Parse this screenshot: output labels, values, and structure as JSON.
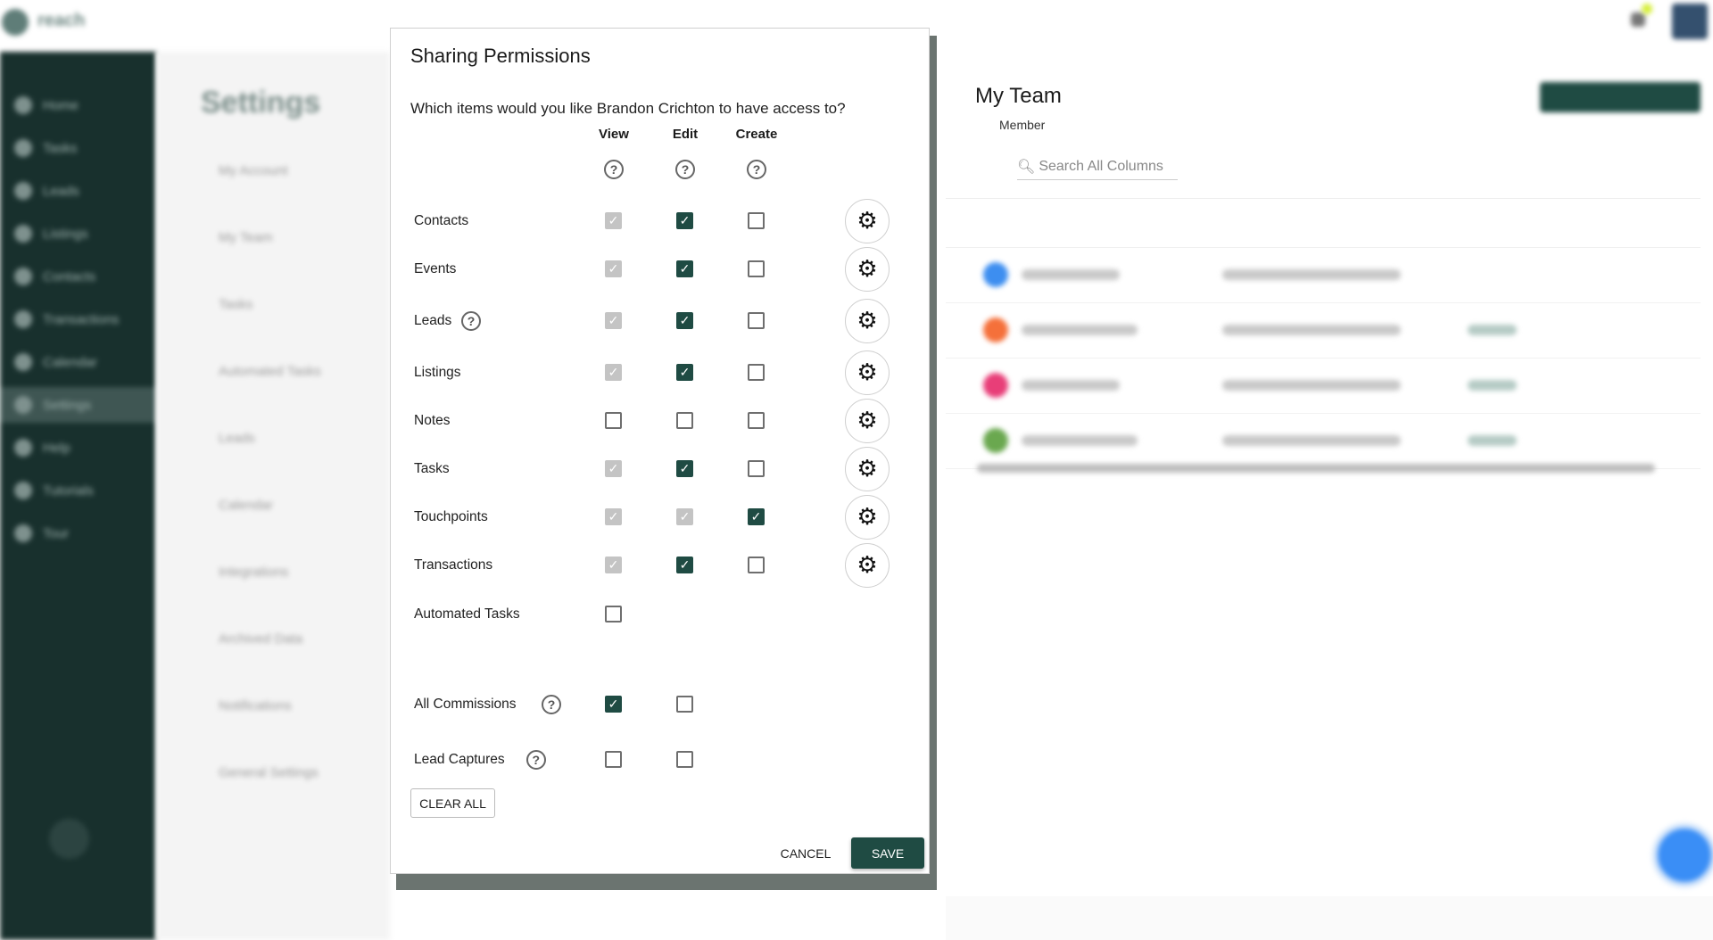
{
  "app": {
    "logo_text": "reach"
  },
  "sidebar": {
    "items": [
      {
        "label": "Home"
      },
      {
        "label": "Tasks"
      },
      {
        "label": "Leads"
      },
      {
        "label": "Listings"
      },
      {
        "label": "Contacts"
      },
      {
        "label": "Transactions"
      },
      {
        "label": "Calendar"
      },
      {
        "label": "Settings",
        "active": true
      },
      {
        "label": "Help"
      },
      {
        "label": "Tutorials"
      },
      {
        "label": "Tour"
      }
    ]
  },
  "settings": {
    "title": "Settings",
    "items": [
      "My Account",
      "My Team",
      "Tasks",
      "Automated Tasks",
      "Leads",
      "Calendar",
      "Integrations",
      "Archived Data",
      "Notifications",
      "General Settings"
    ]
  },
  "team": {
    "title": "My Team",
    "search_placeholder": "Search All Columns",
    "columns": {
      "member": "Member"
    },
    "avatar_colors": [
      "#3d8ef0",
      "#f5703a",
      "#e83e78",
      "#6aa84f"
    ]
  },
  "modal": {
    "title": "Sharing Permissions",
    "question": "Which items would you like Brandon Crichton to have access to?",
    "columns": [
      "View",
      "Edit",
      "Create"
    ],
    "rows": [
      {
        "label": "Contacts",
        "view": "disabled-checked",
        "edit": "checked",
        "create": "unchecked",
        "gear": true
      },
      {
        "label": "Events",
        "view": "disabled-checked",
        "edit": "checked",
        "create": "unchecked",
        "gear": true
      },
      {
        "label": "Leads",
        "help": true,
        "view": "disabled-checked",
        "edit": "checked",
        "create": "unchecked",
        "gear": true
      },
      {
        "label": "Listings",
        "view": "disabled-checked",
        "edit": "checked",
        "create": "unchecked",
        "gear": true
      },
      {
        "label": "Notes",
        "view": "unchecked",
        "edit": "unchecked",
        "create": "unchecked",
        "gear": true
      },
      {
        "label": "Tasks",
        "view": "disabled-checked",
        "edit": "checked",
        "create": "unchecked",
        "gear": true
      },
      {
        "label": "Touchpoints",
        "view": "disabled-checked",
        "edit": "disabled-checked",
        "create": "checked",
        "gear": true
      },
      {
        "label": "Transactions",
        "view": "disabled-checked",
        "edit": "checked",
        "create": "unchecked",
        "gear": true
      },
      {
        "label": "Automated Tasks",
        "view": "unchecked"
      },
      {
        "label": "All Commissions",
        "help": true,
        "view": "checked",
        "edit": "unchecked"
      },
      {
        "label": "Lead Captures",
        "help": true,
        "view": "unchecked",
        "edit": "unchecked"
      }
    ],
    "clear_all": "CLEAR ALL",
    "cancel": "CANCEL",
    "save": "SAVE",
    "accent": "#1f4b43"
  }
}
